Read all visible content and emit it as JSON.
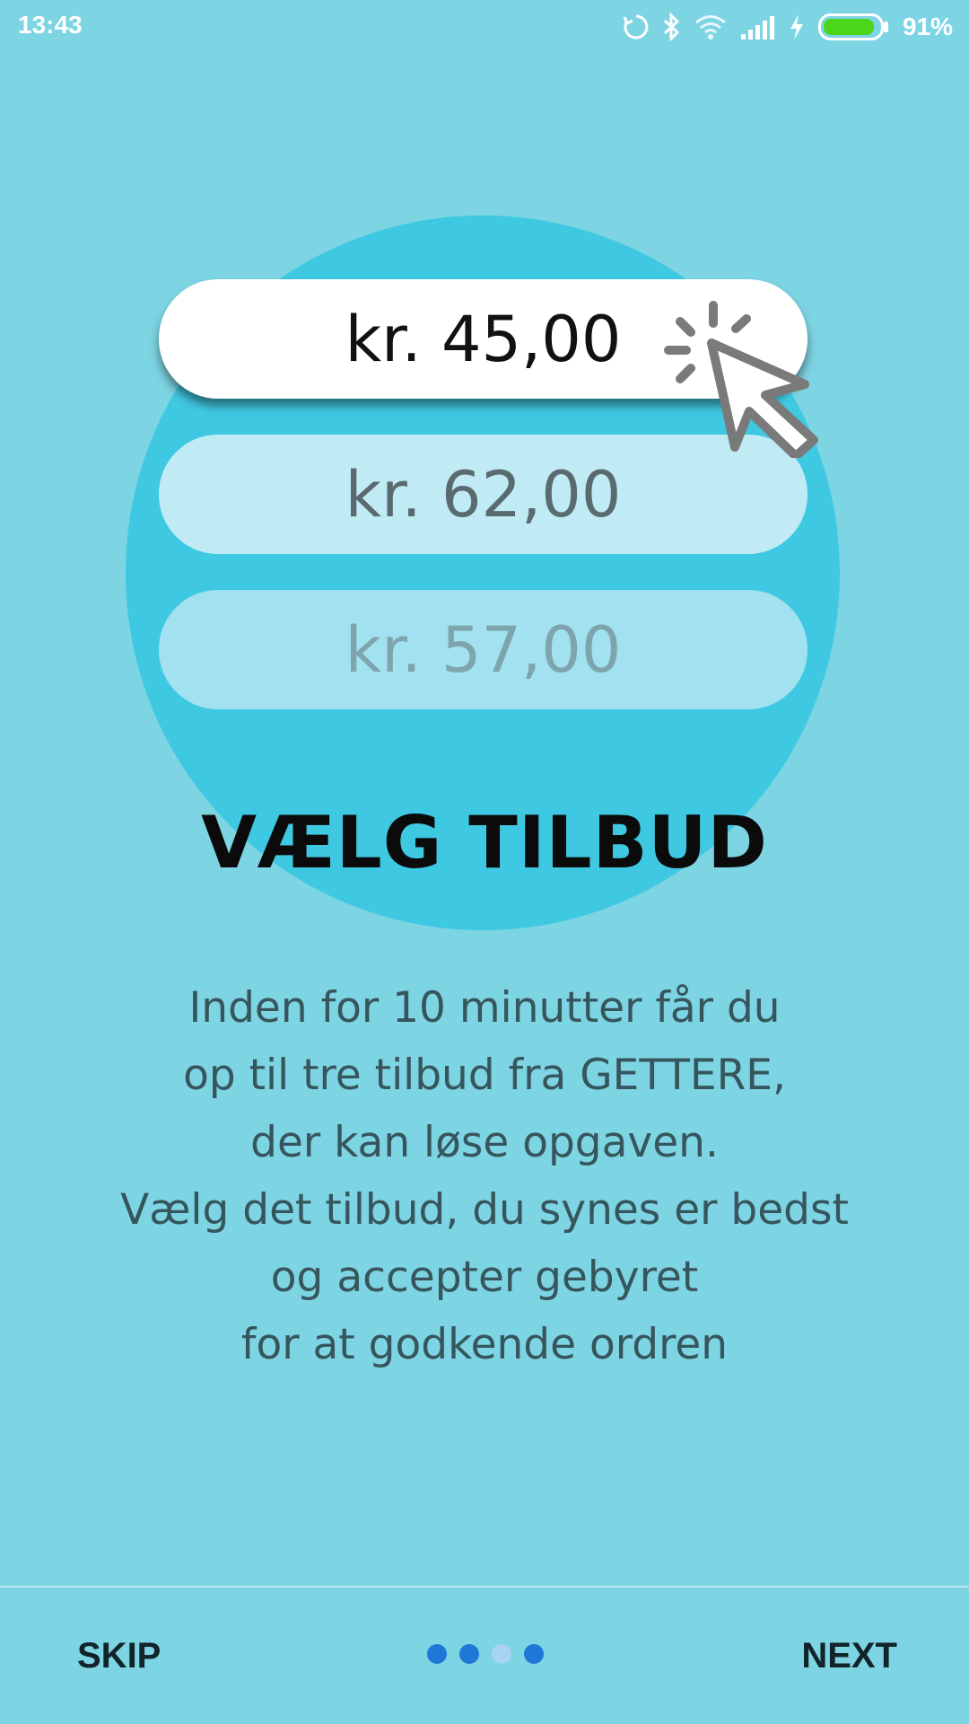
{
  "status_bar": {
    "time": "13:43",
    "battery_percent": "91%",
    "battery_level": 0.91,
    "battery_color": "#4cd61a",
    "icons": [
      "sync-icon",
      "bluetooth-icon",
      "wifi-icon",
      "signal-icon",
      "charging-icon",
      "battery-icon"
    ]
  },
  "offers": [
    {
      "label": "kr. 45,00",
      "state": "selected"
    },
    {
      "label": "kr. 62,00",
      "state": "unselected"
    },
    {
      "label": "kr. 57,00",
      "state": "faded"
    }
  ],
  "illustration": {
    "cursor_icon": "click-cursor-icon",
    "circle_color": "#3fc8e2"
  },
  "title": "VÆLG TILBUD",
  "description_lines": [
    "Inden for 10 minutter får du",
    "op til tre tilbud fra GETTERE,",
    "der kan løse opgaven.",
    "Vælg det tilbud, du synes er bedst",
    "og accepter gebyret",
    "for at godkende ordren"
  ],
  "footer": {
    "skip_label": "SKIP",
    "next_label": "NEXT",
    "page_count": 4,
    "current_page": 3
  },
  "colors": {
    "background": "#7dd4e3",
    "dot": "#1f77d8",
    "dot_active": "#a8d4f2"
  }
}
